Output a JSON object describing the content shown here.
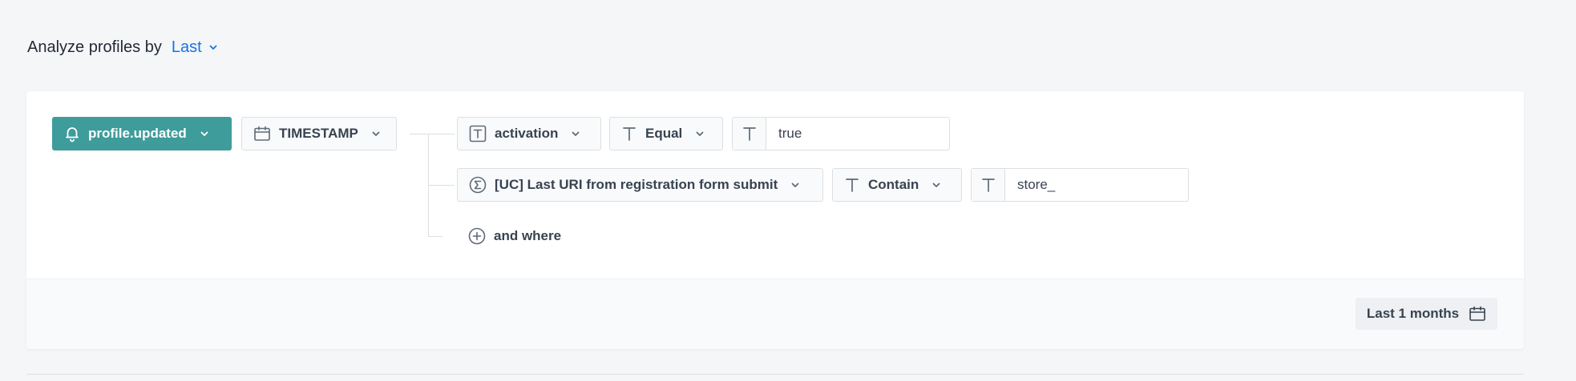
{
  "header": {
    "title": "Analyze profiles by",
    "selected_option": "Last"
  },
  "filter": {
    "event": {
      "label": "profile.updated",
      "icon": "bell-icon"
    },
    "timestamp": {
      "label": "TIMESTAMP",
      "icon": "calendar-icon"
    },
    "conditions": [
      {
        "parameter": "activation",
        "parameter_icon": "text-type-icon",
        "operator": "Equal",
        "operator_icon": "text-operator-icon",
        "value": "true"
      },
      {
        "parameter": "[UC] Last URI from registration form submit",
        "parameter_icon": "sigma-icon",
        "operator": "Contain",
        "operator_icon": "text-operator-icon",
        "value": "store_"
      }
    ],
    "add_condition_label": "and where"
  },
  "footer": {
    "date_range_label": "Last 1 months"
  },
  "colors": {
    "accent": "#3e9c9b",
    "link": "#1a73e8",
    "background": "#f5f6f8"
  }
}
